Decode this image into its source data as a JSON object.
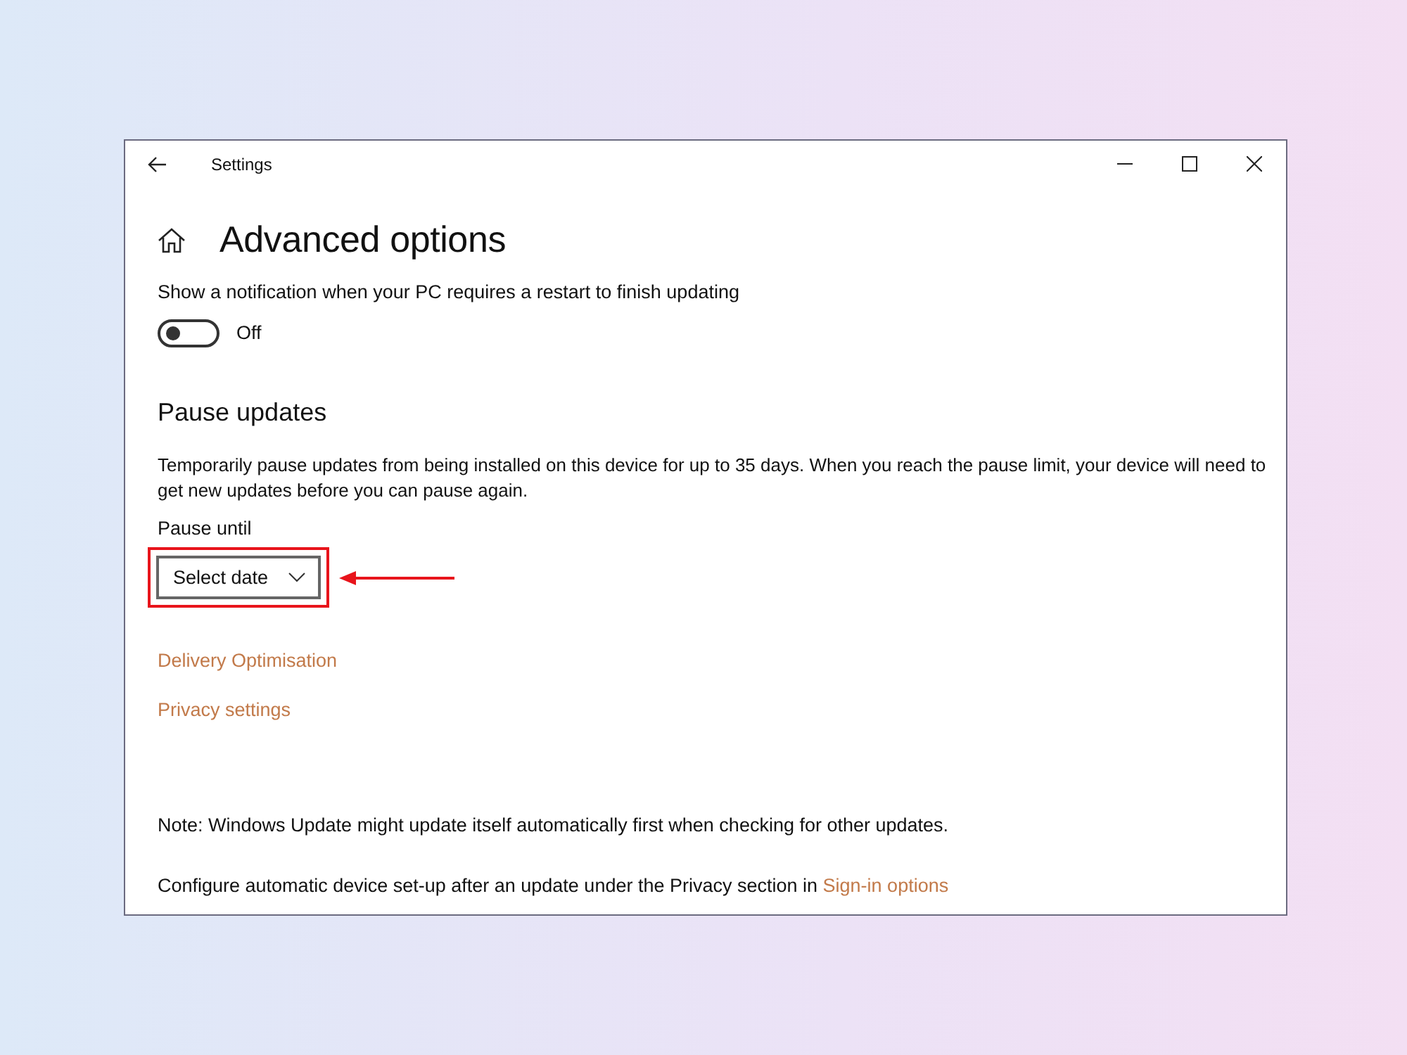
{
  "window": {
    "title": "Settings"
  },
  "page": {
    "title": "Advanced options"
  },
  "notification": {
    "label": "Show a notification when your PC requires a restart to finish updating",
    "toggle": {
      "on": false,
      "state_label": "Off"
    }
  },
  "pause": {
    "heading": "Pause updates",
    "description": "Temporarily pause updates from being installed on this device for up to 35 days. When you reach the pause limit, your device will need to get new updates before you can pause again.",
    "field_label": "Pause until",
    "dropdown": {
      "value": "Select date",
      "highlighted": true
    }
  },
  "links": [
    "Delivery Optimisation",
    "Privacy settings"
  ],
  "note": "Note: Windows Update might update itself automatically first when checking for other updates.",
  "footer": {
    "text": "Configure automatic device set-up after an update under the Privacy section in ",
    "link": "Sign-in options"
  }
}
